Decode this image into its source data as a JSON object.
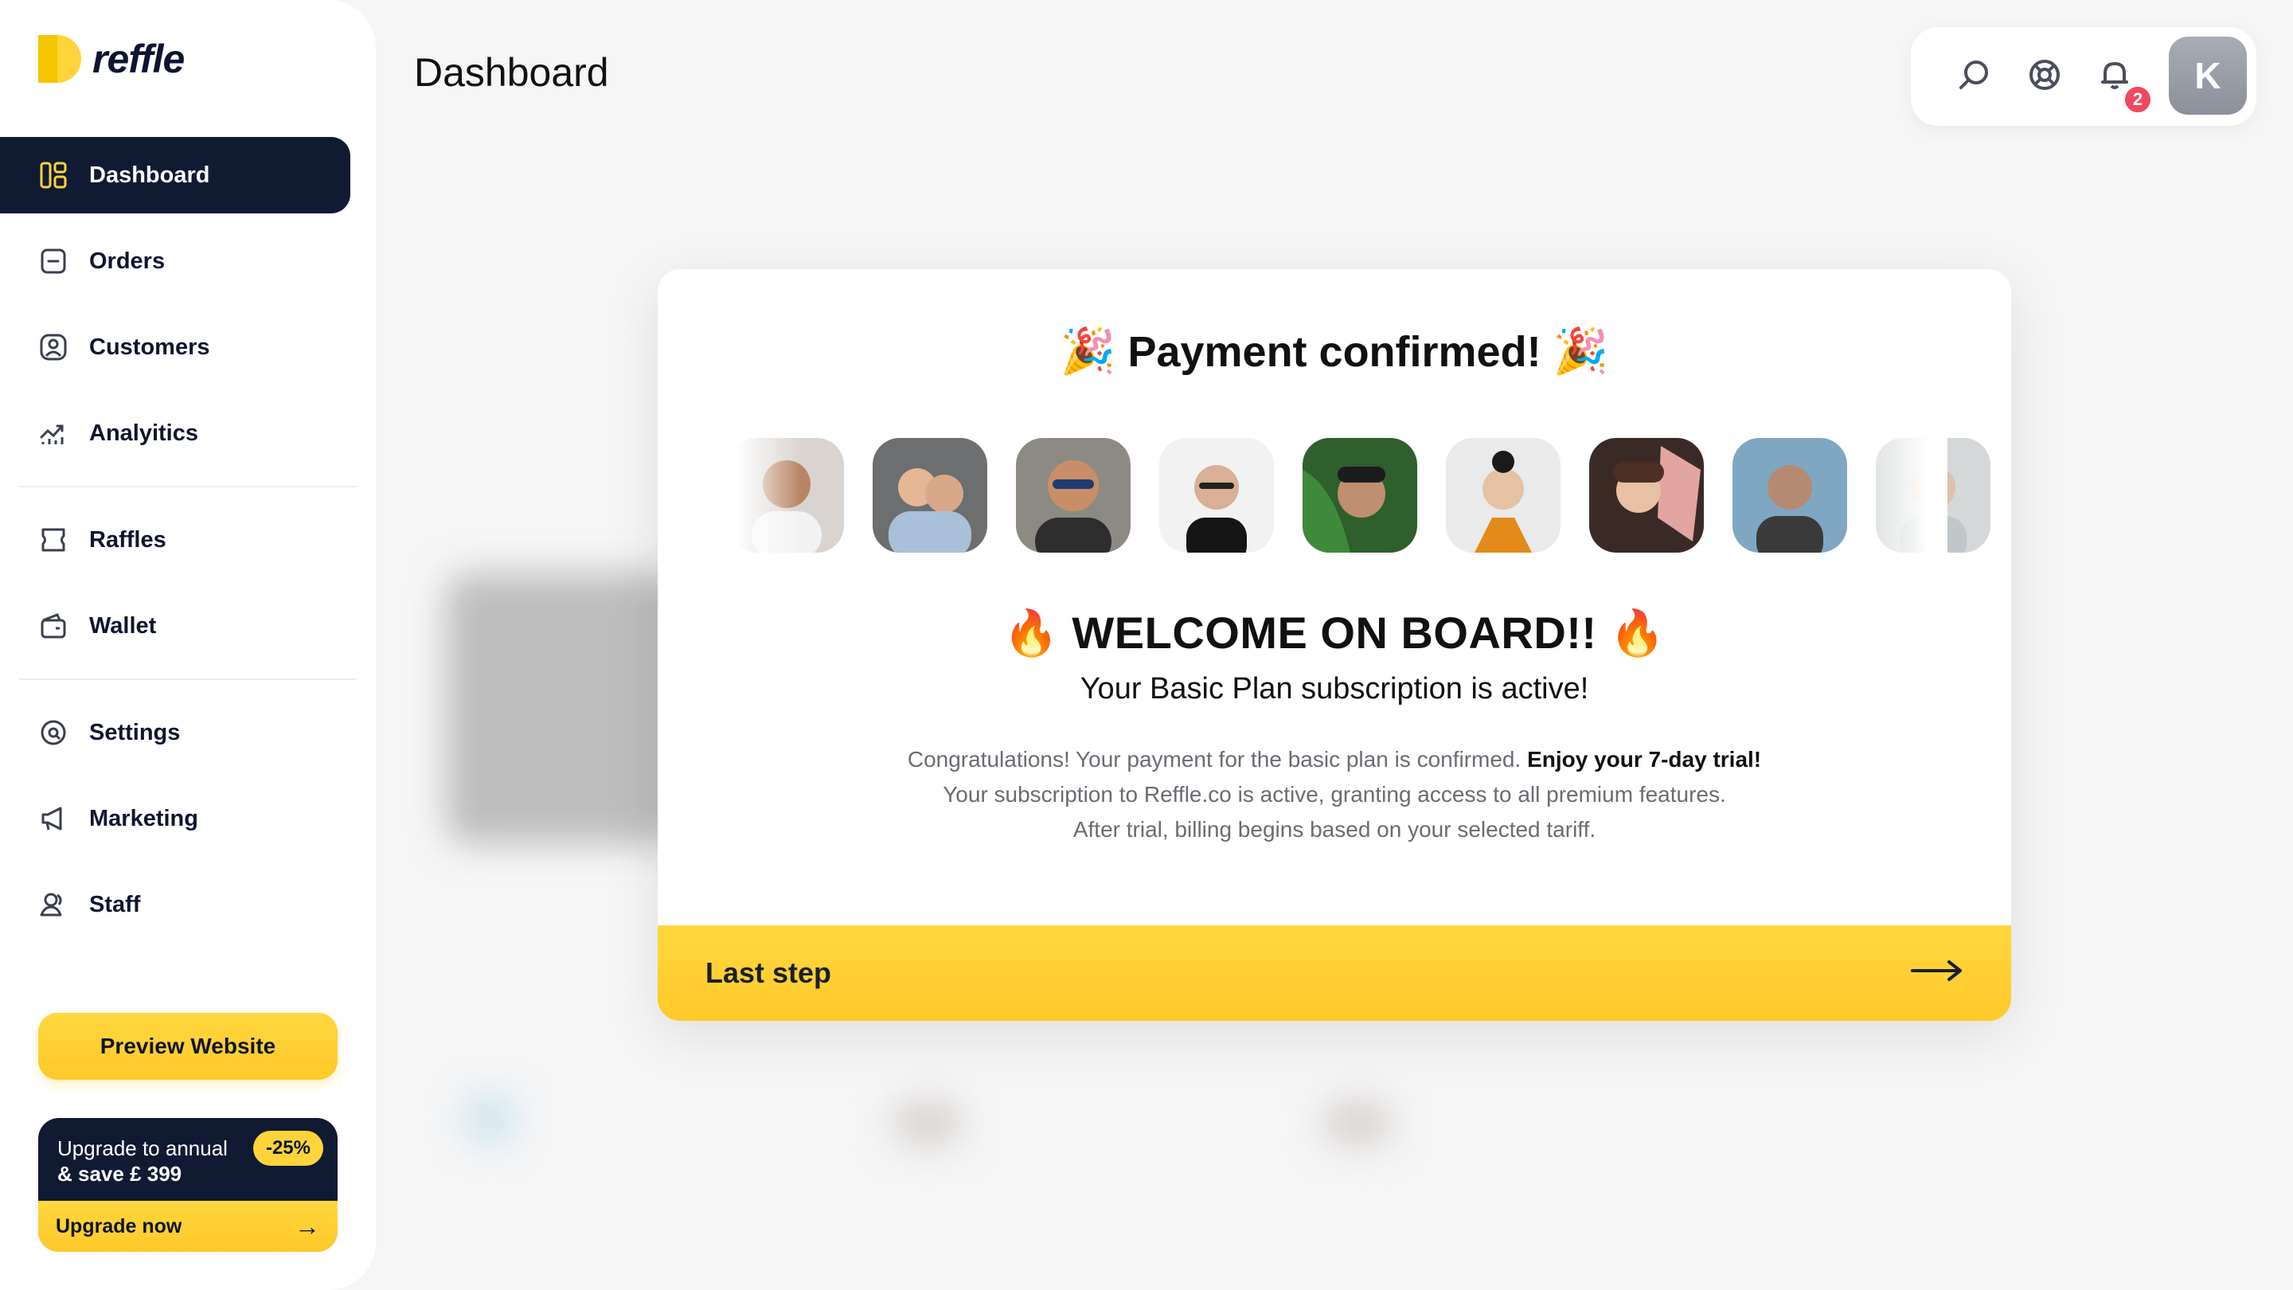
{
  "app": {
    "logo_text": "reffle"
  },
  "sidebar": {
    "items": [
      {
        "label": "Dashboard",
        "icon": "dashboard-icon",
        "active": true
      },
      {
        "label": "Orders",
        "icon": "orders-icon"
      },
      {
        "label": "Customers",
        "icon": "customers-icon"
      },
      {
        "label": "Analyitics",
        "icon": "analytics-icon"
      },
      {
        "label": "Raffles",
        "icon": "ticket-icon"
      },
      {
        "label": "Wallet",
        "icon": "wallet-icon"
      },
      {
        "label": "Settings",
        "icon": "settings-icon"
      },
      {
        "label": "Marketing",
        "icon": "megaphone-icon"
      },
      {
        "label": "Staff",
        "icon": "staff-icon"
      }
    ],
    "preview_button": "Preview Website",
    "upgrade": {
      "line1": "Upgrade to annual",
      "line2": "& save £ 399",
      "discount": "-25%",
      "cta": "Upgrade now"
    }
  },
  "header": {
    "title": "Dashboard",
    "notifications_count": "2",
    "avatar_initial": "K",
    "colors": {
      "accent": "#ffd43b",
      "dark": "#111a33",
      "badge": "#f0495f"
    }
  },
  "modal": {
    "title": "Payment confirmed!",
    "title_emoji": "🎉",
    "welcome": "WELCOME ON BOARD!!",
    "welcome_emoji": "🔥",
    "subtitle": "Your Basic Plan subscription is active!",
    "line1_regular": "Congratulations! Your payment for the basic plan is confirmed. ",
    "line1_bold": "Enjoy your 7-day trial!",
    "line2": "Your subscription to Reffle.co is active, granting access to all premium features.",
    "line3": "After trial, billing begins based on your selected tariff.",
    "cta": "Last step"
  }
}
